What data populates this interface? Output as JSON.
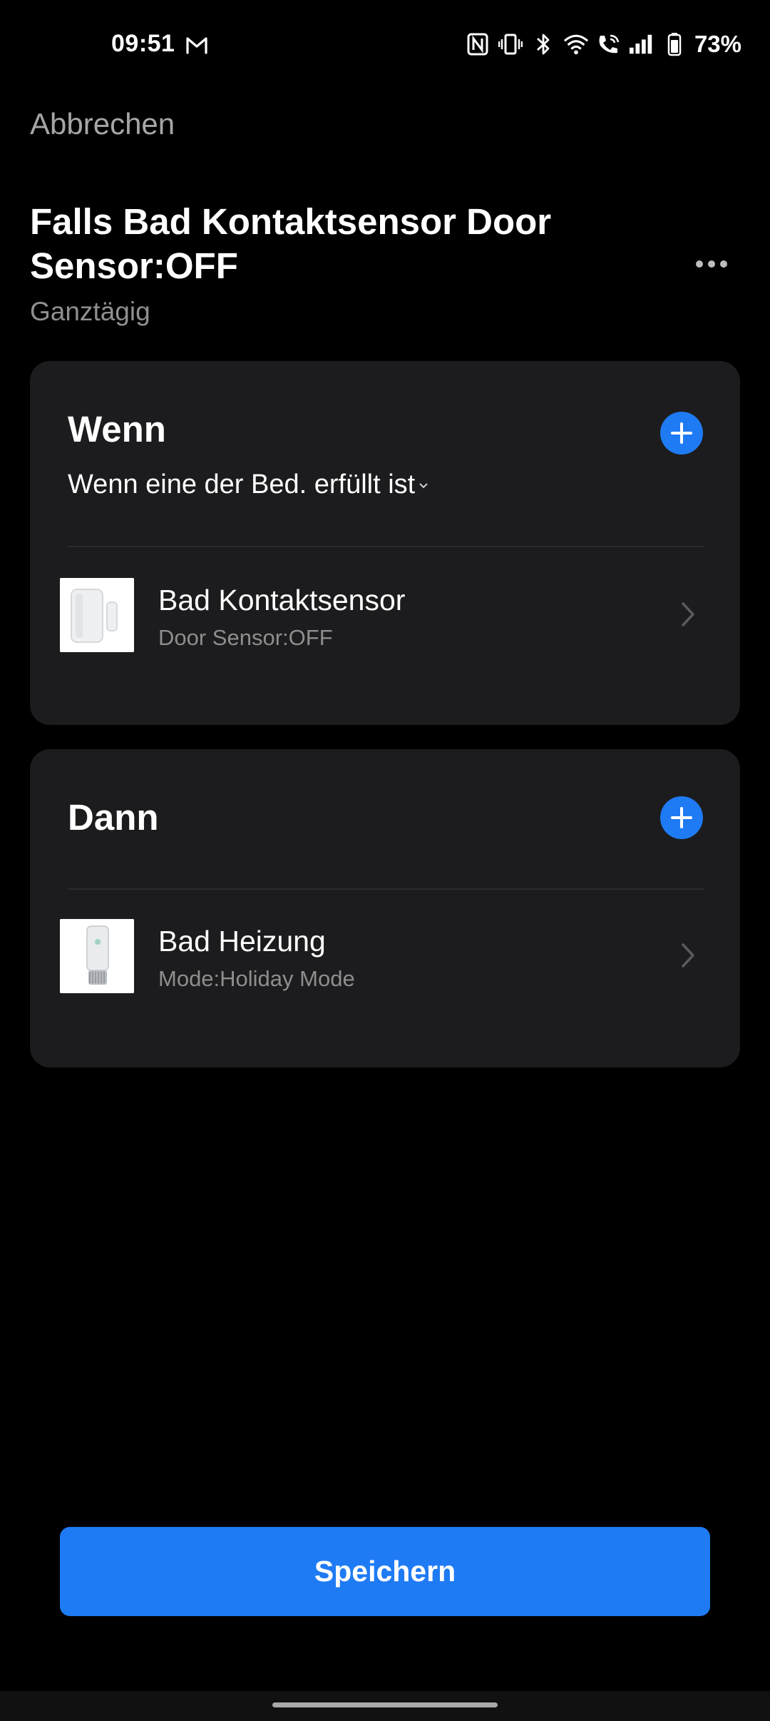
{
  "status_bar": {
    "time": "09:51",
    "left_icons": [
      "gmail-icon"
    ],
    "right_icons": [
      "nfc-icon",
      "vibrate-icon",
      "bluetooth-icon",
      "wifi-icon",
      "wifi-calling-icon",
      "cellular-signal-icon",
      "battery-icon"
    ],
    "battery": "73%"
  },
  "header": {
    "cancel_label": "Abbrechen",
    "title": "Falls Bad Kontaktsensor Door Sensor:OFF",
    "subtitle": "Ganztägig",
    "more_icon": "more-horizontal-icon"
  },
  "when_section": {
    "heading": "Wenn",
    "condition_mode": "Wenn eine der Bed. erfüllt ist",
    "items": [
      {
        "title": "Bad Kontaktsensor",
        "subtitle": "Door Sensor:OFF",
        "thumbnail": "door-sensor-image"
      }
    ]
  },
  "then_section": {
    "heading": "Dann",
    "items": [
      {
        "title": "Bad Heizung",
        "subtitle": "Mode:Holiday Mode",
        "thumbnail": "thermostat-valve-image"
      }
    ]
  },
  "footer": {
    "save_label": "Speichern"
  },
  "colors": {
    "accent": "#1f7bf4",
    "background": "#000000",
    "card": "#1c1c1e",
    "secondary_text": "#8e8e8e"
  }
}
